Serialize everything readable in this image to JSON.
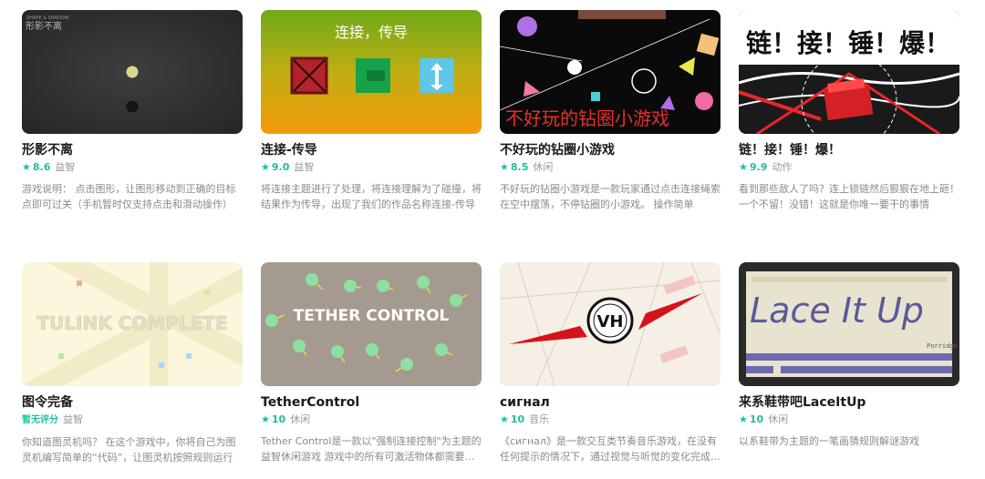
{
  "games": [
    {
      "title": "形影不离",
      "rating": "8.6",
      "genre": "益智",
      "desc": "游戏说明：  点击图形，让图形移动到正确的目标点即可过关（手机暂时仅支持点击和滑动操作）",
      "thumb_text": "形影不离",
      "thumb_sub": "SHAPE & SHADOW"
    },
    {
      "title": "连接-传导",
      "rating": "9.0",
      "genre": "益智",
      "desc": "将连接主题进行了处理，将连接理解为了碰撞，将结果作为传导，出现了我们的作品名称连接-传导",
      "thumb_text": "连接，传导"
    },
    {
      "title": "不好玩的钻圈小游戏",
      "rating": "8.5",
      "genre": "休闲",
      "desc": "不好玩的钻圈小游戏是一款玩家通过点击连接绳索在空中摆荡，不停钻圈的小游戏。 操作简单",
      "thumb_text": "不好玩的钻圈小游戏"
    },
    {
      "title": "链！接！锤！爆！",
      "rating": "9.9",
      "genre": "动作",
      "desc": "看到那些敌人了吗？连上锁链然后狠狠在地上砸！一个不留！没错！这就是你唯一要干的事情",
      "thumb_text": "链！接！锤！爆！"
    },
    {
      "title": "图令完备",
      "rating_text": "暂无评分",
      "genre": "益智",
      "desc": "你知道图灵机吗？  在这个游戏中，你将自己为图灵机编写简单的“代码”，让图灵机按照规则运行",
      "thumb_text": "TULINK COMPLETE"
    },
    {
      "title": "TetherControl",
      "rating": "10",
      "genre": "休闲",
      "desc": "Tether Control是一款以\"强制连接控制\"为主题的益智休闲游戏 游戏中的所有可激活物体都需要连接",
      "thumb_text": "TETHER CONTROL"
    },
    {
      "title": "сигнал",
      "rating": "10",
      "genre": "音乐",
      "desc": "《сигнал》是一款交互类节奏音乐游戏，在没有任何提示的情况下，通过视觉与听觉的变化完成游戏",
      "thumb_text": "VH"
    },
    {
      "title": "来系鞋带吧LaceItUp",
      "rating": "10",
      "genre": "休闲",
      "desc": "以系鞋带为主题的一笔画猜规则解谜游戏",
      "thumb_text": "Lace It Up",
      "thumb_sub": "Porridge"
    }
  ],
  "colors": {
    "accent": "#1fbf9a",
    "muted": "#8a8a8a"
  }
}
